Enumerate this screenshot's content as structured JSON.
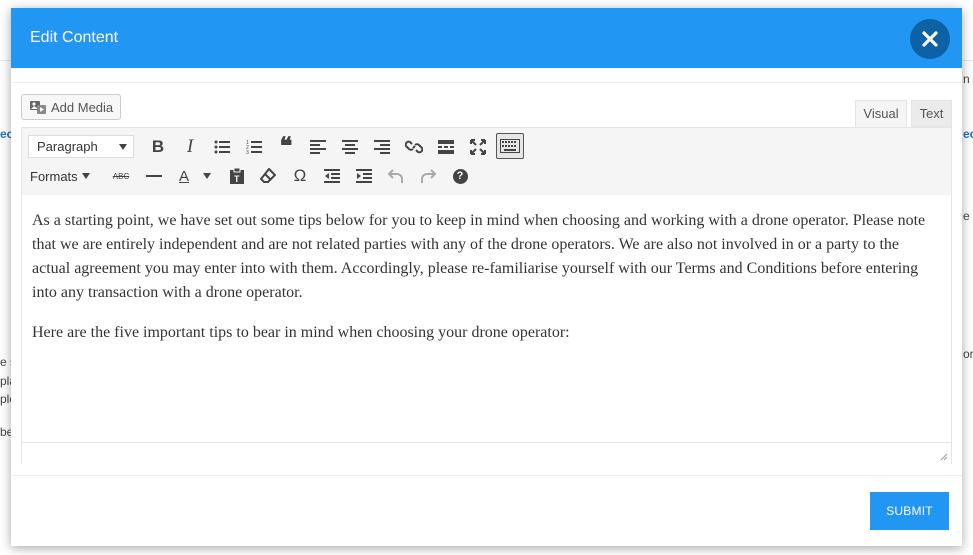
{
  "background": {
    "left_fragments": [
      "ect",
      "e sc",
      "pla",
      "ple",
      "be"
    ],
    "right_fragments": [
      "n",
      "ect",
      "e",
      "or"
    ]
  },
  "modal": {
    "title": "Edit Content",
    "close_icon": "close-icon",
    "add_media_label": "Add Media",
    "tabs": {
      "visual": "Visual",
      "text": "Text"
    },
    "toolbar": {
      "paragraph_select": "Paragraph",
      "formats_label": "Formats",
      "row1_icons": [
        "bold-icon",
        "italic-icon",
        "bulleted-list-icon",
        "numbered-list-icon",
        "blockquote-icon",
        "align-left-icon",
        "align-center-icon",
        "align-right-icon",
        "link-icon",
        "read-more-icon",
        "fullscreen-icon",
        "toolbar-toggle-icon"
      ],
      "row2_icons": [
        "strikethrough-icon",
        "horizontal-line-icon",
        "text-color-icon",
        "paste-as-text-icon",
        "clear-formatting-icon",
        "special-character-icon",
        "outdent-icon",
        "indent-icon",
        "undo-icon",
        "redo-icon",
        "help-icon"
      ],
      "strike_label": "ABC",
      "text_color_label": "A",
      "omega": "Ω",
      "bold": "B",
      "italic": "I",
      "quote": "❝",
      "help": "?"
    },
    "content": {
      "paragraphs": [
        "As a starting point, we have set out some tips below for you to keep in mind when choosing and working with a drone operator. Please note that we are entirely independent and are not related parties with any of the drone operators. We are also not involved in or a party to the actual agreement you may enter into with them. Accordingly, please re-familiarise yourself with our Terms and Conditions before entering into any transaction with a drone operator.",
        "Here are the five important tips to bear in mind when choosing your drone operator:"
      ]
    },
    "submit_label": "SUBMIT",
    "colors": {
      "header": "#2196f3",
      "close_button": "#0d61a5",
      "submit": "#2196f3"
    }
  }
}
